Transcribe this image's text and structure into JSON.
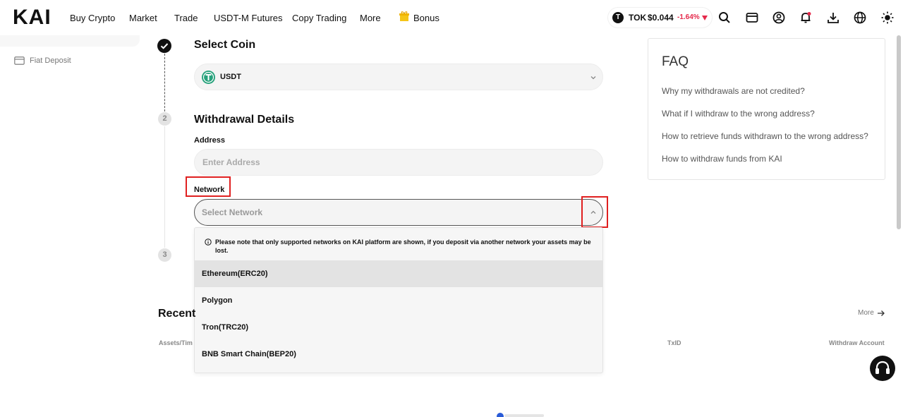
{
  "header": {
    "logo": "KAI",
    "nav": [
      "Buy Crypto",
      "Market",
      "Trade",
      "USDT-M Futures",
      "Copy Trading",
      "More",
      "Bonus"
    ],
    "ticker": {
      "symbol": "TOK",
      "price": "$0.044",
      "change": "-1.64%",
      "change_color": "#e5294b"
    },
    "icons": [
      "search-icon",
      "wallet-icon",
      "user-icon",
      "bell-icon",
      "download-icon",
      "globe-icon",
      "theme-sun-icon"
    ]
  },
  "sidebar": {
    "items": [
      {
        "label": "Fiat Deposit",
        "icon": "card-icon"
      }
    ]
  },
  "steps": {
    "step1": {
      "title": "Select Coin",
      "coin": "USDT"
    },
    "step2": {
      "number": "2",
      "title": "Withdrawal Details",
      "address_label": "Address",
      "address_placeholder": "Enter Address",
      "network_label": "Network",
      "network_placeholder": "Select Network"
    },
    "step3": {
      "number": "3"
    }
  },
  "network_dropdown": {
    "note": "Please note that only supported networks on KAI platform are shown, if you deposit via another network your assets may be lost.",
    "options": [
      "Ethereum(ERC20)",
      "Polygon",
      "Tron(TRC20)",
      "BNB Smart Chain(BEP20)"
    ],
    "highlighted": "Ethereum(ERC20)"
  },
  "recent": {
    "title": "Recent",
    "more": "More",
    "columns": [
      "Assets/Tim",
      "TxID",
      "Withdraw Account"
    ]
  },
  "faq": {
    "title": "FAQ",
    "links": [
      "Why my withdrawals are not credited?",
      "What if I withdraw to the wrong address?",
      "How to retrieve funds withdrawn to the wrong address?",
      "How to withdraw funds from KAI"
    ]
  },
  "colors": {
    "accent": "#111111",
    "highlight_box": "#e02020",
    "usdt": "#26a17b"
  }
}
